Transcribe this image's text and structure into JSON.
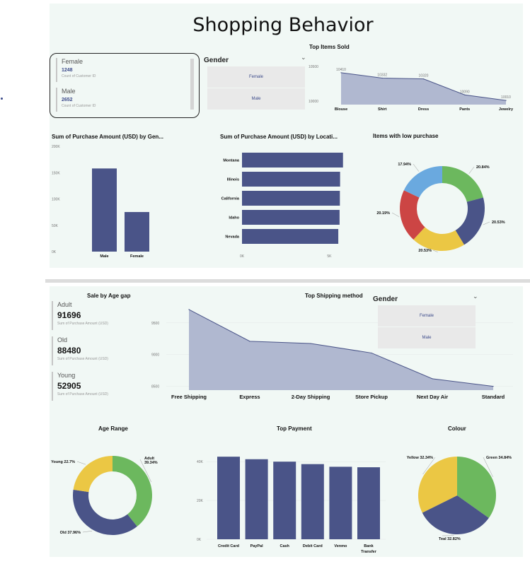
{
  "header": {
    "title": "Shopping Behavior"
  },
  "cards": [
    {
      "label": "Female",
      "value": "1248",
      "sub": "Count of Customer ID"
    },
    {
      "label": "Male",
      "value": "2652",
      "sub": "Count of Customer ID"
    }
  ],
  "slicer1": {
    "title": "Gender",
    "items": [
      "Female",
      "Male"
    ]
  },
  "slicer2": {
    "title": "Gender",
    "items": [
      "Female",
      "Male"
    ]
  },
  "kpis": [
    {
      "label": "Adult",
      "value": "91696",
      "sub": "Sum of Purchase Amount (USD)"
    },
    {
      "label": "Old",
      "value": "88480",
      "sub": "Sum of Purchase Amount (USD)"
    },
    {
      "label": "Young",
      "value": "52905",
      "sub": "Sum of Purchase Amount (USD)"
    }
  ],
  "colors": {
    "series": "#4a5488",
    "area": "#b0b8d0",
    "green": "#6cb85e",
    "red": "#cc4544",
    "yellow": "#ebc744",
    "blue": "#6aa9df",
    "panel": "#f1f8f5"
  },
  "chart_data": [
    {
      "id": "top-items",
      "type": "area",
      "title": "Top Items Sold",
      "categories": [
        "Blouse",
        "Shirt",
        "Dress",
        "Pants",
        "Jewelry"
      ],
      "values": [
        10410,
        10332,
        10320,
        10090,
        10010
      ],
      "data_labels": [
        "10410",
        "10332",
        "10320",
        "10090",
        "10010"
      ],
      "yticks": [
        "10500",
        "10000"
      ],
      "ylim": [
        9950,
        10500
      ]
    },
    {
      "id": "purchase-gender",
      "type": "bar",
      "title": "Sum of Purchase Amount (USD) by Gen...",
      "categories": [
        "Male",
        "Female"
      ],
      "values": [
        157890,
        75191
      ],
      "yticks": [
        "200K",
        "150K",
        "100K",
        "50K",
        "0K"
      ],
      "ylim": [
        0,
        200000
      ]
    },
    {
      "id": "purchase-location",
      "type": "bar",
      "orientation": "horizontal",
      "title": "Sum of Purchase Amount (USD) by Locati...",
      "categories": [
        "Montana",
        "Illinois",
        "California",
        "Idaho",
        "Nevada"
      ],
      "values": [
        5784,
        5617,
        5605,
        5587,
        5514
      ],
      "xticks": [
        "0K",
        "5K"
      ],
      "xlim": [
        0,
        6200
      ]
    },
    {
      "id": "low-purchase",
      "type": "pie",
      "donut": true,
      "title": "Items with low purchase",
      "labels": [
        "20.84%",
        "20.53%",
        "20.53%",
        "20.19%",
        "17.94%"
      ],
      "values": [
        20.84,
        20.53,
        20.53,
        20.19,
        17.94
      ],
      "colors": [
        "#6cb85e",
        "#4a5488",
        "#ebc744",
        "#cc4544",
        "#6aa9df"
      ]
    },
    {
      "id": "age-gap",
      "type": "table",
      "title": "Sale by Age gap"
    },
    {
      "id": "shipping",
      "type": "area",
      "title": "Top Shipping method",
      "categories": [
        "Free Shipping",
        "Express",
        "2-Day Shipping",
        "Store Pickup",
        "Next Day Air",
        "Standard"
      ],
      "values": [
        9710,
        9210,
        9175,
        9025,
        8620,
        8500
      ],
      "yticks": [
        "9500",
        "9000",
        "8500"
      ],
      "ylim": [
        8440,
        9720
      ]
    },
    {
      "id": "age-range",
      "type": "pie",
      "donut": true,
      "title": "Age Range",
      "slices": [
        {
          "name": "Adult",
          "label": "Adult 39.34%",
          "value": 39.34,
          "color": "#6cb85e"
        },
        {
          "name": "Old",
          "label": "Old 37.96%",
          "value": 37.96,
          "color": "#4a5488"
        },
        {
          "name": "Young",
          "label": "Young 22.7%",
          "value": 22.7,
          "color": "#ebc744"
        }
      ]
    },
    {
      "id": "payment",
      "type": "bar",
      "title": "Top Payment",
      "categories": [
        "Credit Card",
        "PayPal",
        "Cash",
        "Debit Card",
        "Venmo",
        "Bank Transfer"
      ],
      "values": [
        42567,
        41264,
        40002,
        38742,
        37374,
        37123
      ],
      "yticks": [
        "40K",
        "20K",
        "0K"
      ],
      "ylim": [
        0,
        47000
      ]
    },
    {
      "id": "colour",
      "type": "pie",
      "title": "Colour",
      "slices": [
        {
          "name": "Green",
          "label": "Green 34.84%",
          "value": 34.84,
          "color": "#6cb85e"
        },
        {
          "name": "Teal",
          "label": "Teal 32.82%",
          "value": 32.82,
          "color": "#4a5488"
        },
        {
          "name": "Yellow",
          "label": "Yellow 32.34%",
          "value": 32.34,
          "color": "#ebc744"
        }
      ]
    }
  ]
}
